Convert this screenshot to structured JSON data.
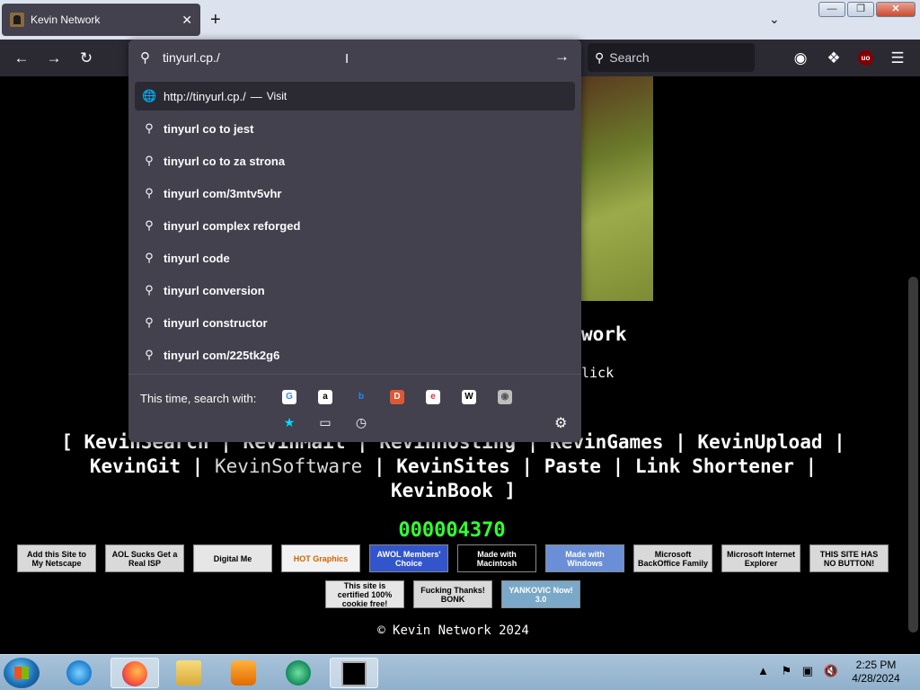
{
  "tab": {
    "title": "Kevin Network",
    "close": "✕"
  },
  "newtab": "+",
  "window_buttons": {
    "minimize": "—",
    "maximize": "❐",
    "close": "✕"
  },
  "toolbar": {
    "search_placeholder": "Search",
    "ublock": "uo"
  },
  "urlbar": {
    "value": "tinyurl.cp./",
    "visit_result": {
      "url": "http://tinyurl.cp./",
      "dash": "—",
      "action": "Visit"
    },
    "suggestions": [
      "tinyurl co to jest",
      "tinyurl co to za strona",
      "tinyurl com/3mtv5vhr",
      "tinyurl complex reforged",
      "tinyurl code",
      "tinyurl conversion",
      "tinyurl constructor",
      "tinyurl com/225tk2g6"
    ],
    "search_with_label": "This time, search with:",
    "engines": [
      {
        "name": "google-icon",
        "glyph": "G",
        "color": "#4285f4",
        "bg": "#ffffff"
      },
      {
        "name": "amazon-icon",
        "glyph": "a",
        "color": "#000000",
        "bg": "#ffffff"
      },
      {
        "name": "bing-icon",
        "glyph": "b",
        "color": "#1a8cff",
        "bg": "#42414d"
      },
      {
        "name": "duckduckgo-icon",
        "glyph": "D",
        "color": "#ffffff",
        "bg": "#de5833"
      },
      {
        "name": "ebay-icon",
        "glyph": "e",
        "color": "#e53238",
        "bg": "#ffffff"
      },
      {
        "name": "wikipedia-icon",
        "glyph": "W",
        "color": "#000000",
        "bg": "#ffffff"
      },
      {
        "name": "search-engine-icon",
        "glyph": "◉",
        "color": "#555555",
        "bg": "#bdbdbd"
      }
    ]
  },
  "page": {
    "heading_fragment": "work",
    "click_fragment": "lick",
    "nav_row1": [
      "KevinSearch",
      "KevinMail",
      "KevinHosting",
      "KevinGames",
      "KevinUpload"
    ],
    "nav_row2": [
      "KevinGit",
      "KevinSoftware",
      "KevinSites",
      "Paste",
      "Link Shortener"
    ],
    "nav_row3": [
      "KevinBook"
    ],
    "counter": "000004370",
    "badges_row1": [
      {
        "text": "Add this Site to My Netscape",
        "bg": "#d9d9d9",
        "fg": "#000000"
      },
      {
        "text": "AOL Sucks Get a Real ISP",
        "bg": "#d9d9d9",
        "fg": "#000000"
      },
      {
        "text": "Digital Me",
        "bg": "#e6e6e6",
        "fg": "#000000"
      },
      {
        "text": "HOT Graphics",
        "bg": "#f2f2f2",
        "fg": "#cc6600"
      },
      {
        "text": "AWOL Members' Choice",
        "bg": "#3355cc",
        "fg": "#ffffff"
      },
      {
        "text": "Made with Macintosh",
        "bg": "#000000",
        "fg": "#ffffff"
      },
      {
        "text": "Made with Windows",
        "bg": "#6b8fd6",
        "fg": "#ffffff"
      },
      {
        "text": "Microsoft BackOffice Family",
        "bg": "#d9d9d9",
        "fg": "#000000"
      },
      {
        "text": "Microsoft Internet Explorer",
        "bg": "#d9d9d9",
        "fg": "#000000"
      },
      {
        "text": "THIS SITE HAS NO BUTTON!",
        "bg": "#d9d9d9",
        "fg": "#000000"
      }
    ],
    "badges_row2": [
      {
        "text": "This site is certified 100% cookie free!",
        "bg": "#e6e6e6",
        "fg": "#000000"
      },
      {
        "text": "Fucking Thanks! BONK",
        "bg": "#d9d9d9",
        "fg": "#000000"
      },
      {
        "text": "YANKOVIC Now! 3.0",
        "bg": "#7aa8c8",
        "fg": "#ffffff"
      }
    ],
    "copyright": "© Kevin Network 2024"
  },
  "taskbar": {
    "time": "2:25 PM",
    "date": "4/28/2024"
  }
}
